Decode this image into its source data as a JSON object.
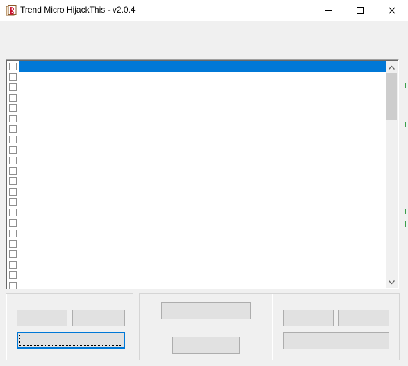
{
  "window": {
    "title": "Trend Micro HijackThis - v2.0.4",
    "icon": "hijackthis-app-icon",
    "controls": {
      "minimize_icon": "minimize-icon",
      "maximize_icon": "maximize-icon",
      "close_icon": "close-icon"
    }
  },
  "list": {
    "row_count": 22,
    "selected_index": 0,
    "rows": [
      "",
      "",
      "",
      "",
      "",
      "",
      "",
      "",
      "",
      "",
      "",
      "",
      "",
      "",
      "",
      "",
      "",
      "",
      "",
      "",
      "",
      ""
    ],
    "checked": [
      false,
      false,
      false,
      false,
      false,
      false,
      false,
      false,
      false,
      false,
      false,
      false,
      false,
      false,
      false,
      false,
      false,
      false,
      false,
      false,
      false,
      false
    ],
    "scrollbar": {
      "up_icon": "scroll-up-arrow-icon",
      "down_icon": "scroll-down-arrow-icon"
    }
  },
  "colors": {
    "selection": "#0078d7",
    "face": "#f0f0f0",
    "button_face": "#e1e1e1",
    "accent_edge": "#3c9e4a"
  },
  "groups": {
    "left": {
      "buttons": [
        "",
        "",
        ""
      ]
    },
    "middle": {
      "buttons": [
        "",
        ""
      ]
    },
    "right": {
      "buttons": [
        "",
        "",
        ""
      ]
    }
  }
}
